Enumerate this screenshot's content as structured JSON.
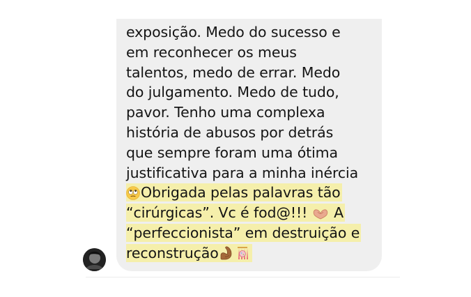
{
  "message": {
    "plain_lines": [
      "exposição. Medo do sucesso e",
      "em reconhecer os meus",
      "talentos, medo de errar. Medo",
      "do julgamento. Medo de tudo,",
      "pavor. Tenho  uma complexa",
      "história de abusos por detrás",
      "que sempre foram uma ótima",
      "justificativa para a minha inércia"
    ],
    "highlight_line_1": "Obrigada pelas palavras tão",
    "highlight_line_2": "“cirúrgicas”. Vc é fod@!!!",
    "highlight_line_2_tail": "A",
    "highlight_line_3": "“perfeccionista” em destruição e",
    "highlight_line_4": "reconstrução"
  },
  "icons": {
    "rolling_eyes": "rolling-eyes-emoji",
    "heart_hands": "heart-hands-emoji",
    "flexed_biceps": "flexed-biceps-emoji",
    "confetti_ball": "confetti-ball-emoji",
    "avatar": "user-avatar"
  },
  "colors": {
    "bubble": "#efefef",
    "highlight": "#f5efab",
    "text": "#141414"
  }
}
